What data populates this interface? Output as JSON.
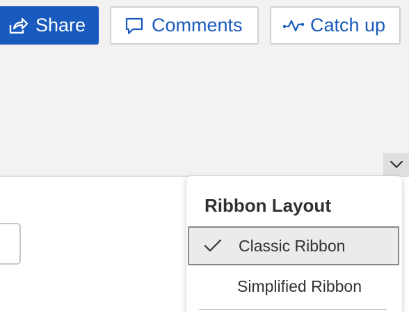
{
  "toolbar": {
    "share_label": "Share",
    "comments_label": "Comments",
    "catchup_label": "Catch up"
  },
  "ribbon_layout_menu": {
    "title": "Ribbon Layout",
    "items": [
      {
        "label": "Classic Ribbon",
        "checked": true
      },
      {
        "label": "Simplified Ribbon",
        "checked": false
      }
    ]
  },
  "icons": {
    "share": "share-icon",
    "comments": "comment-icon",
    "catchup": "activity-icon",
    "toggle": "chevron-down-icon",
    "check": "checkmark-icon"
  },
  "colors": {
    "accent": "#185abd",
    "background": "#f3f2f1",
    "menu_selected": "#edebe9"
  }
}
